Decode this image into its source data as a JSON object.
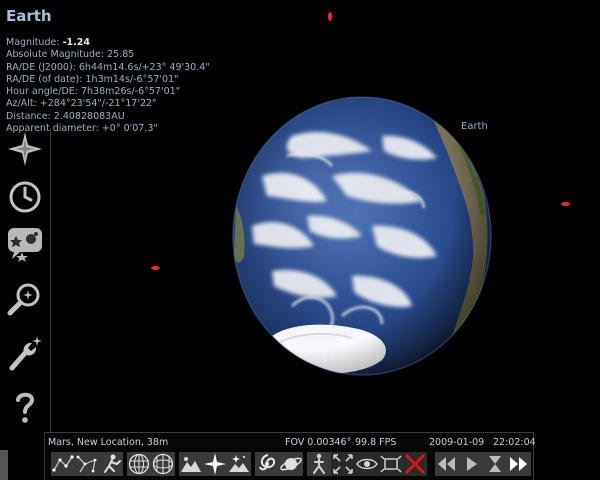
{
  "object_info": {
    "name": "Earth",
    "rows": [
      {
        "label": "Magnitude:",
        "value": "-1.24"
      },
      {
        "label": "Absolute Magnitude:",
        "value": "25.85"
      },
      {
        "label": "RA/DE (J2000):",
        "value": "6h44m14.6s/+23° 49'30.4\""
      },
      {
        "label": "RA/DE (of date):",
        "value": "1h3m14s/-6°57'01\""
      },
      {
        "label": "Hour angle/DE:",
        "value": "7h38m26s/-6°57'01\""
      },
      {
        "label": "Az/Alt:",
        "value": "+284°23'54\"/-21°17'22\""
      },
      {
        "label": "Distance:",
        "value": "2.40828083AU"
      },
      {
        "label": "Apparent diameter:",
        "value": "+0° 0'07.3\""
      }
    ]
  },
  "sky": {
    "planet_label": "Earth"
  },
  "left_bar": {
    "buttons": [
      {
        "name": "location-window-button",
        "icon": "compass-star-icon"
      },
      {
        "name": "date-time-window-button",
        "icon": "clock-icon"
      },
      {
        "name": "sky-view-options-button",
        "icon": "sky-options-icon"
      },
      {
        "name": "search-window-button",
        "icon": "magnifier-icon"
      },
      {
        "name": "configuration-window-button",
        "icon": "wrench-icon"
      },
      {
        "name": "help-window-button",
        "icon": "question-mark-icon"
      }
    ]
  },
  "status": {
    "location": "Mars, New Location, 38m",
    "fov": "FOV 0.00346°",
    "fps": "99.8 FPS",
    "date": "2009-01-09",
    "time": "22:02:04"
  },
  "toolbar": {
    "buttons": [
      {
        "name": "constellation-lines-button",
        "icon": "constellation-lines-icon"
      },
      {
        "name": "constellation-labels-button",
        "icon": "constellation-labels-icon"
      },
      {
        "name": "constellation-art-button",
        "icon": "constellation-art-icon"
      },
      {
        "name": "equatorial-grid-button",
        "icon": "equatorial-grid-icon"
      },
      {
        "name": "azimuthal-grid-button",
        "icon": "azimuthal-grid-icon"
      },
      {
        "name": "ground-button",
        "icon": "ground-icon"
      },
      {
        "name": "cardinal-points-button",
        "icon": "cardinal-points-icon"
      },
      {
        "name": "atmosphere-button",
        "icon": "atmosphere-icon"
      },
      {
        "name": "nebulae-button",
        "icon": "nebula-icon"
      },
      {
        "name": "planet-labels-button",
        "icon": "planet-icon"
      },
      {
        "name": "equatorial-mount-button",
        "icon": "mount-icon"
      },
      {
        "name": "center-on-selected-button",
        "icon": "center-icon"
      },
      {
        "name": "night-mode-button",
        "icon": "eye-icon"
      },
      {
        "name": "full-screen-button",
        "icon": "fullscreen-icon"
      },
      {
        "name": "quit-button",
        "icon": "close-x-icon"
      },
      {
        "name": "decrease-time-speed-button",
        "icon": "rewind-icon"
      },
      {
        "name": "real-time-speed-button",
        "icon": "play-icon"
      },
      {
        "name": "current-time-button",
        "icon": "hourglass-icon"
      },
      {
        "name": "increase-time-speed-button",
        "icon": "fast-forward-icon"
      }
    ]
  },
  "colors": {
    "accent": "#a9bfdc",
    "panel_border": "#3a3a3a",
    "button_bg": "#3a3a3a",
    "quit_red": "#d01818",
    "red_star": "#e03030",
    "ocean": "#28458a"
  }
}
